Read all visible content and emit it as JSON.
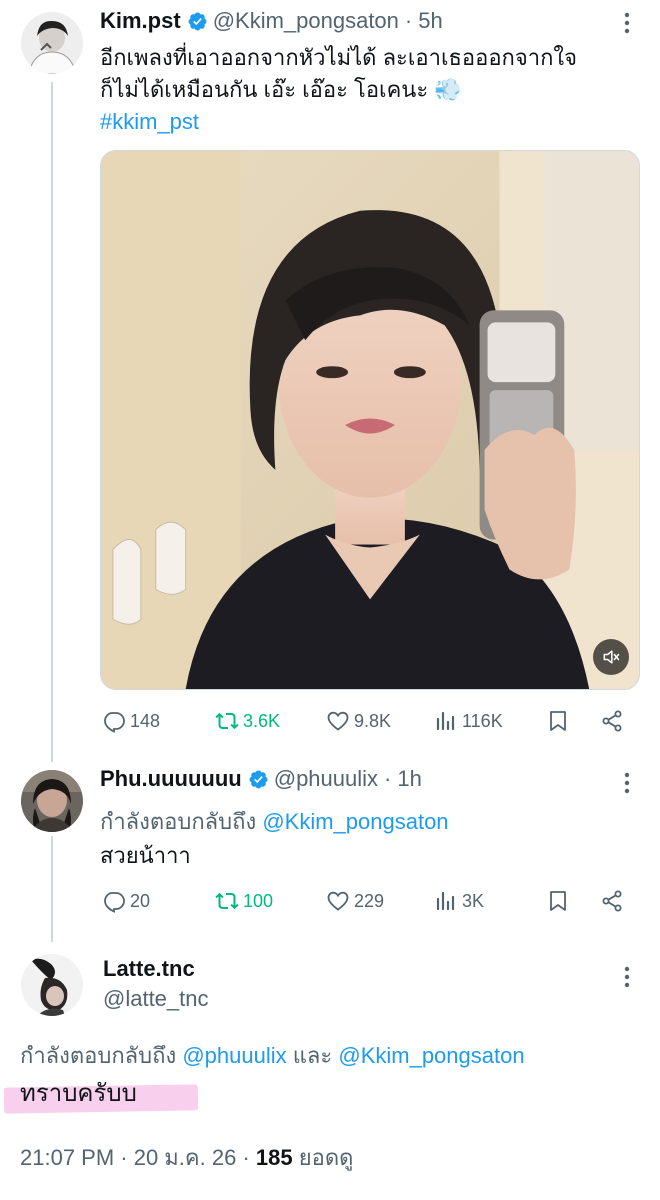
{
  "tweets": [
    {
      "display_name": "Kim.pst",
      "handle": "@Kkim_pongsaton",
      "time": "5h",
      "text_line1": "อีกเพลงที่เอาออกจากหัวไม่ได้ ละเอาเธอออกจากใจ",
      "text_line2": "ก็ไม่ได้เหมือนกัน เอ๊ะ เอ๊อะ โอเคนะ",
      "emoji": "💨",
      "hashtag": "#kkim_pst",
      "stats": {
        "replies": "148",
        "reposts": "3.6K",
        "likes": "9.8K",
        "views": "116K"
      }
    },
    {
      "display_name": "Phu.uuuuuuu",
      "handle": "@phuuulix",
      "time": "1h",
      "reply_prefix": "กำลังตอบกลับถึง",
      "reply_to": "@Kkim_pongsaton",
      "text": "สวยน้าาา",
      "stats": {
        "replies": "20",
        "reposts": "100",
        "likes": "229",
        "views": "3K"
      }
    },
    {
      "display_name": "Latte.tnc",
      "handle": "@latte_tnc",
      "reply_prefix": "กำลังตอบกลับถึง",
      "reply_to_1": "@phuuulix",
      "reply_and": "และ",
      "reply_to_2": "@Kkim_pongsaton",
      "text": "ทราบครับบ",
      "timestamp": "21:07 PM · 20 ม.ค. 26 ·",
      "views_count": "185",
      "views_label": "ยอดดู"
    }
  ],
  "colors": {
    "link": "#1d9bf0",
    "repost": "#00ba7c",
    "secondary_text": "#536471",
    "verified": "#1d9bf0",
    "highlight": "#f7c7ea"
  },
  "icons": [
    "more-icon",
    "verified-icon",
    "reply-icon",
    "repost-icon",
    "like-icon",
    "views-icon",
    "bookmark-icon",
    "share-icon",
    "mute-icon"
  ]
}
